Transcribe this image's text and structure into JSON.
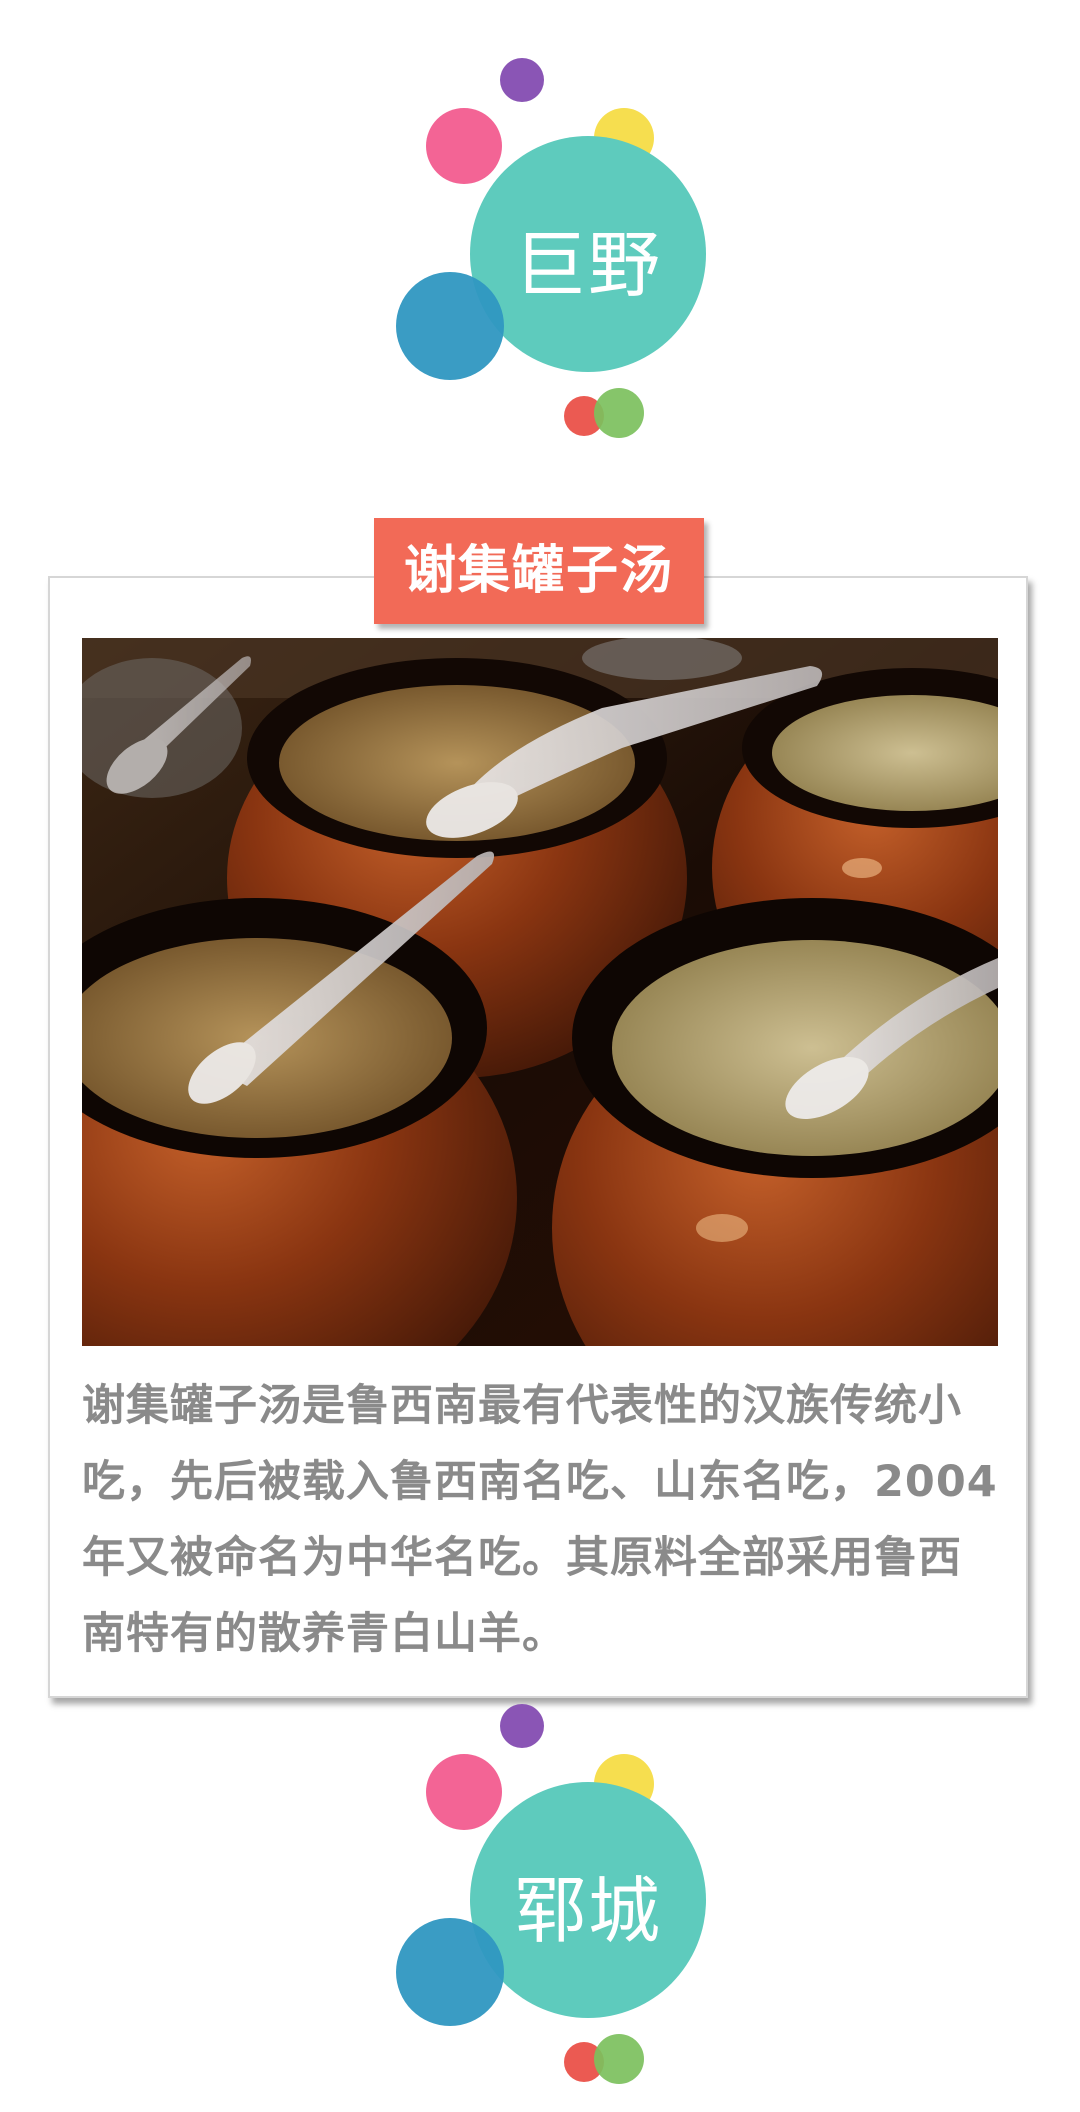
{
  "sections": [
    {
      "region_name": "巨野",
      "dish_title": "谢集罐子汤",
      "description": "谢集罐子汤是鲁西南最有代表性的汉族传统小吃，先后被载入鲁西南名吃、山东名吃，2004年又被命名为中华名吃。其原料全部采用鲁西南特有的散养青白山羊。"
    },
    {
      "region_name": "郓城"
    }
  ],
  "colors": {
    "teal": "#5ecbbd",
    "pink": "#f25c8f",
    "purple": "#8a55b5",
    "yellow": "#f5dc46",
    "blue": "#2f97c1",
    "red": "#eb5a52",
    "green": "#7cc05d",
    "tag": "#f26a57",
    "caption_text": "#8a8a8a"
  },
  "image": {
    "subject": "clay soup pots with spoons"
  }
}
